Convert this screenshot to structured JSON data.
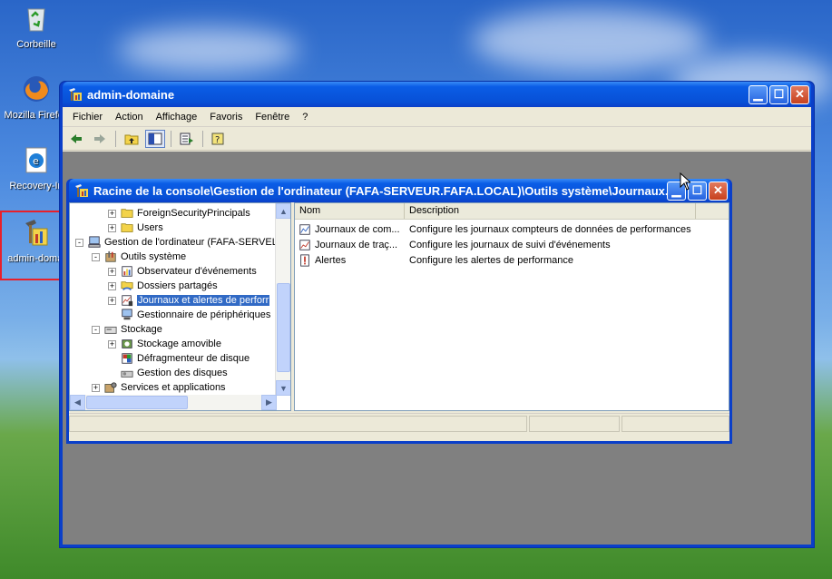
{
  "desktop": {
    "icons": [
      {
        "label": "Corbeille"
      },
      {
        "label": "Mozilla Firefox"
      },
      {
        "label": "Recovery-In"
      },
      {
        "label": "admin-domai"
      }
    ]
  },
  "main_window": {
    "title": "admin-domaine",
    "menu": [
      "Fichier",
      "Action",
      "Affichage",
      "Favoris",
      "Fenêtre",
      "?"
    ],
    "toolbar_icons": [
      "back-arrow-icon",
      "forward-arrow-icon",
      "up-folder-icon",
      "show-hide-tree-icon",
      "export-list-icon",
      "help-icon"
    ]
  },
  "inner_window": {
    "title": "Racine de la console\\Gestion de l'ordinateur (FAFA-SERVEUR.FAFA.LOCAL)\\Outils système\\Journaux...",
    "tree": [
      {
        "label": "ForeignSecurityPrincipals",
        "expander": "+",
        "icon": "folder-icon",
        "level": 2,
        "selected": false
      },
      {
        "label": "Users",
        "expander": "+",
        "icon": "folder-icon",
        "level": 2,
        "selected": false
      },
      {
        "label": "Gestion de l'ordinateur (FAFA-SERVEL",
        "expander": "-",
        "icon": "computer-icon",
        "level": 0,
        "selected": false
      },
      {
        "label": "Outils système",
        "expander": "-",
        "icon": "tools-icon",
        "level": 1,
        "selected": false
      },
      {
        "label": "Observateur d'événements",
        "expander": "+",
        "icon": "event-viewer-icon",
        "level": 2,
        "selected": false
      },
      {
        "label": "Dossiers partagés",
        "expander": "+",
        "icon": "shared-folder-icon",
        "level": 2,
        "selected": false
      },
      {
        "label": "Journaux et alertes de perforr",
        "expander": "+",
        "icon": "perf-logs-icon",
        "level": 2,
        "selected": true
      },
      {
        "label": "Gestionnaire de périphériques",
        "expander": "",
        "icon": "device-manager-icon",
        "level": 2,
        "selected": false
      },
      {
        "label": "Stockage",
        "expander": "-",
        "icon": "storage-icon",
        "level": 1,
        "selected": false
      },
      {
        "label": "Stockage amovible",
        "expander": "+",
        "icon": "removable-storage-icon",
        "level": 2,
        "selected": false
      },
      {
        "label": "Défragmenteur de disque",
        "expander": "",
        "icon": "defrag-icon",
        "level": 2,
        "selected": false
      },
      {
        "label": "Gestion des disques",
        "expander": "",
        "icon": "disk-management-icon",
        "level": 2,
        "selected": false
      },
      {
        "label": "Services et applications",
        "expander": "+",
        "icon": "services-icon",
        "level": 1,
        "selected": false
      }
    ],
    "list": {
      "columns": [
        "Nom",
        "Description"
      ],
      "rows": [
        {
          "name": "Journaux de com...",
          "description": "Configure les journaux compteurs de données de performances",
          "icon": "counter-log-icon"
        },
        {
          "name": "Journaux de traç...",
          "description": "Configure les journaux de suivi d'événements",
          "icon": "trace-log-icon"
        },
        {
          "name": "Alertes",
          "description": "Configure les alertes de performance",
          "icon": "alert-icon"
        }
      ]
    }
  },
  "colors": {
    "titlebar_blue": "#0a5de6",
    "selection_blue": "#316ac5",
    "highlight_red": "#e8202a"
  }
}
